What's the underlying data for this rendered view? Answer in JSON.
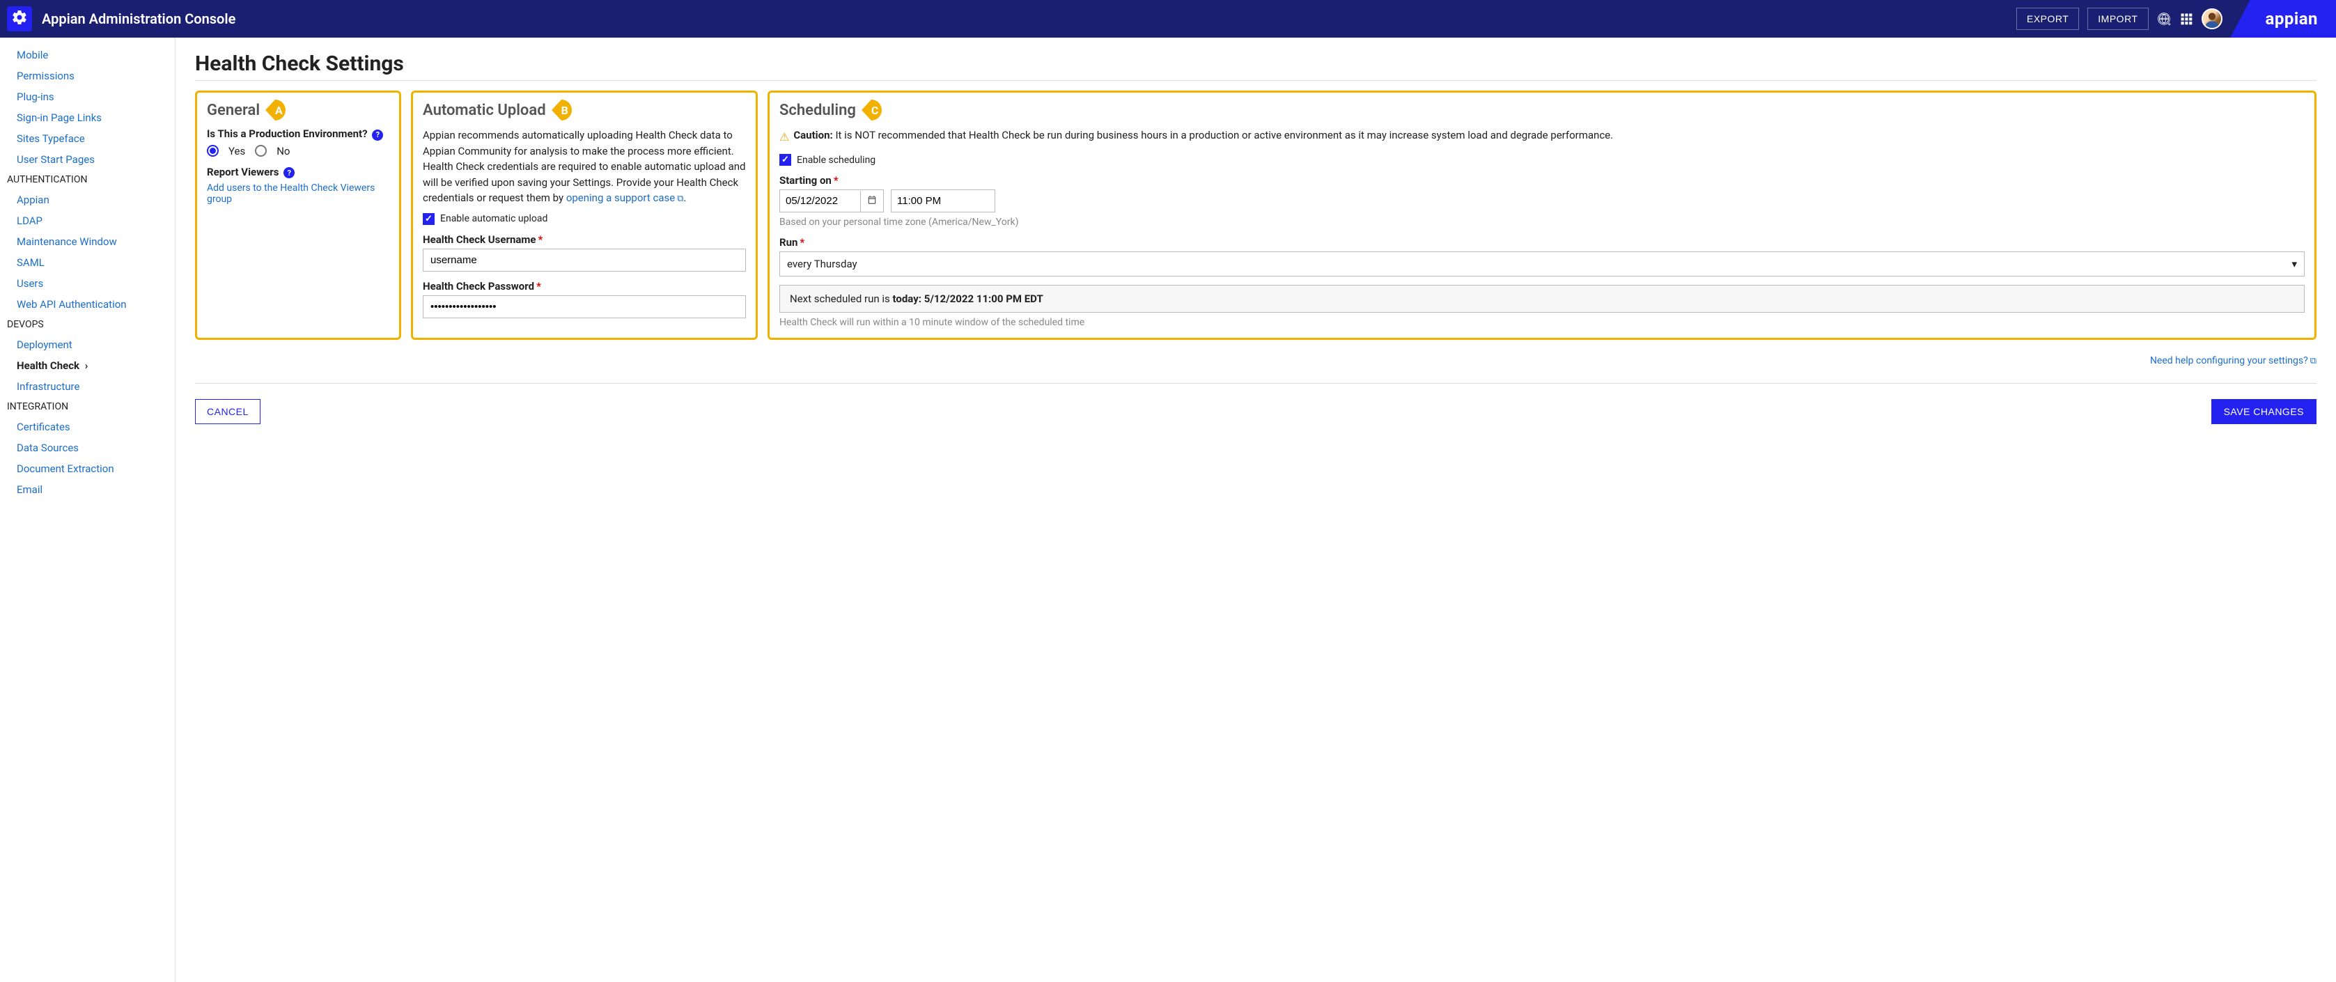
{
  "header": {
    "title": "Appian Administration Console",
    "export": "EXPORT",
    "import": "IMPORT",
    "brand": "appian"
  },
  "sidebar": {
    "top_links": [
      "Mobile",
      "Permissions",
      "Plug-ins",
      "Sign-in Page Links",
      "Sites Typeface",
      "User Start Pages"
    ],
    "categories": [
      {
        "name": "AUTHENTICATION",
        "items": [
          "Appian",
          "LDAP",
          "Maintenance Window",
          "SAML",
          "Users",
          "Web API Authentication"
        ]
      },
      {
        "name": "DEVOPS",
        "items": [
          "Deployment",
          "Health Check",
          "Infrastructure"
        ],
        "active": "Health Check"
      },
      {
        "name": "INTEGRATION",
        "items": [
          "Certificates",
          "Data Sources",
          "Document Extraction",
          "Email"
        ]
      }
    ]
  },
  "page": {
    "title": "Health Check Settings",
    "help_link": "Need help configuring your settings?",
    "cancel": "CANCEL",
    "save": "SAVE CHANGES"
  },
  "general": {
    "badge": "A",
    "heading": "General",
    "prod_label": "Is This a Production Environment?",
    "yes": "Yes",
    "no": "No",
    "prod_value": "Yes",
    "report_viewers_label": "Report Viewers",
    "add_users_link": "Add users to the Health Check Viewers group"
  },
  "autoupload": {
    "badge": "B",
    "heading": "Automatic Upload",
    "text_prefix": "Appian recommends automatically uploading Health Check data to Appian Community for analysis to make the process more efficient. Health Check credentials are required to enable automatic upload and will be verified upon saving your Settings. Provide your Health Check credentials or request them by ",
    "link_text": "opening a support case",
    "enable_label": "Enable automatic upload",
    "enable_value": true,
    "username_label": "Health Check Username",
    "username_value": "username",
    "password_label": "Health Check Password",
    "password_value": "••••••••••••••••••"
  },
  "scheduling": {
    "badge": "C",
    "heading": "Scheduling",
    "caution_label": "Caution:",
    "caution_text": " It is NOT recommended that Health Check be run during business hours in a production or active environment as it may increase system load and degrade performance.",
    "enable_label": "Enable scheduling",
    "enable_value": true,
    "starting_label": "Starting on",
    "date_value": "05/12/2022",
    "time_value": "11:00 PM",
    "tz_hint": "Based on your personal time zone (America/New_York)",
    "run_label": "Run",
    "run_value": "every Thursday",
    "next_run_prefix": "Next scheduled run is ",
    "next_run_bold": "today: 5/12/2022 11:00 PM EDT",
    "window_hint": "Health Check will run within a 10 minute window of the scheduled time"
  }
}
